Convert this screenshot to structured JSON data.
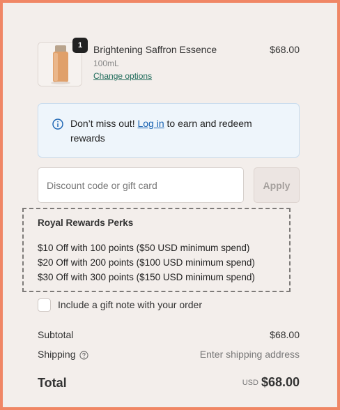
{
  "product": {
    "quantity": "1",
    "name": "Brightening Saffron Essence",
    "variant": "100mL",
    "change_options": "Change options",
    "price": "$68.00"
  },
  "banner": {
    "icon": "info-icon",
    "text_before": "Don’t miss out!",
    "login_link": "Log in",
    "text_after": "to earn and redeem rewards"
  },
  "discount": {
    "placeholder": "Discount code or gift card",
    "value": "",
    "apply_label": "Apply"
  },
  "perks": {
    "title": "Royal Rewards Perks",
    "items": [
      "$10 Off with 100 points ($50 USD minimum spend)",
      "$20 Off with 200 points ($100 USD minimum spend)",
      "$30 Off with 300 points ($150 USD minimum spend)"
    ]
  },
  "gift_note": {
    "label": "Include a gift note with your order",
    "checked": false
  },
  "totals": {
    "subtotal_label": "Subtotal",
    "subtotal_value": "$68.00",
    "shipping_label": "Shipping",
    "shipping_value": "Enter shipping address",
    "total_label": "Total",
    "total_currency": "USD",
    "total_value": "$68.00"
  },
  "colors": {
    "accent_border": "#f08665",
    "link_green": "#1f6b5a",
    "link_blue": "#1862b2",
    "banner_bg": "#eef5fb",
    "page_bg": "#f3eeeb"
  }
}
